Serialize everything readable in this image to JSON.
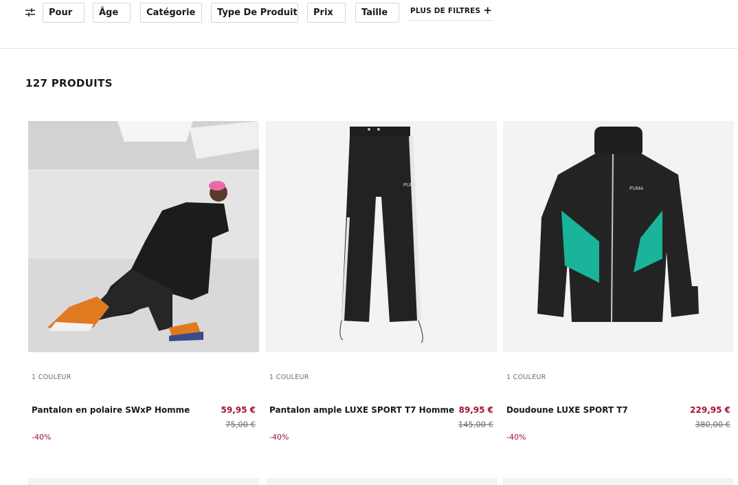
{
  "filters": {
    "items": [
      {
        "label": "Pour"
      },
      {
        "label": "Âge"
      },
      {
        "label": "Catégorie"
      },
      {
        "label": "Type De Produit"
      },
      {
        "label": "Prix"
      },
      {
        "label": "Taille"
      }
    ],
    "more_label": "PLUS DE FILTRES"
  },
  "results": {
    "count_label": "127 PRODUITS"
  },
  "products": [
    {
      "colors": "1 COULEUR",
      "name": "Pantalon en polaire SWxP Homme",
      "price": "59,95 €",
      "old_price": "75,00 €",
      "discount": "-40%",
      "image": "model-kneeling-fleece-photo"
    },
    {
      "colors": "1 COULEUR",
      "name": "Pantalon ample LUXE SPORT T7 Homme",
      "price": "89,95 €",
      "old_price": "145,00 €",
      "discount": "-40%",
      "image": "black-track-pants-photo"
    },
    {
      "colors": "1 COULEUR",
      "name": "Doudoune LUXE SPORT T7",
      "price": "229,95 €",
      "old_price": "380,00 €",
      "discount": "-40%",
      "image": "black-green-puffer-jacket-photo"
    }
  ],
  "colors": {
    "accent": "#a4132f",
    "border": "#d6d6d6",
    "tile_bg": "#f3f3f3"
  }
}
